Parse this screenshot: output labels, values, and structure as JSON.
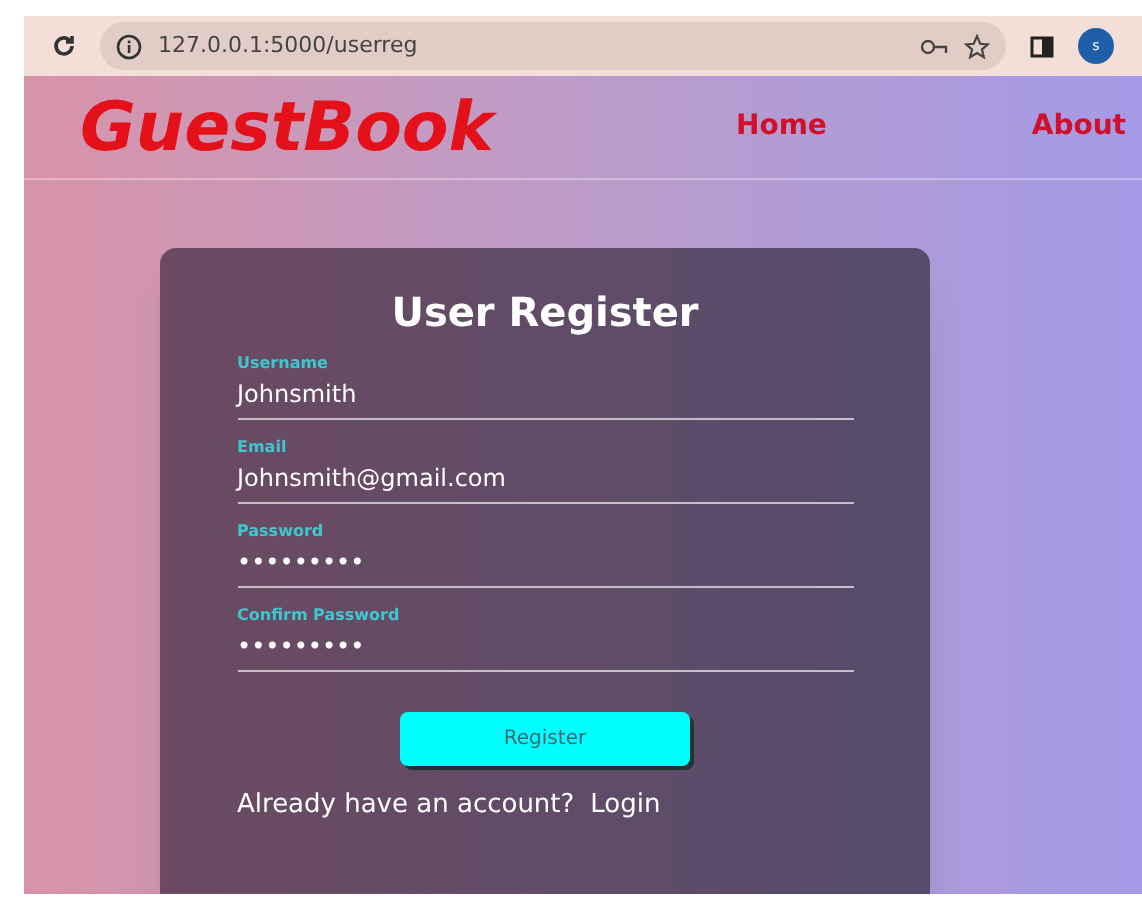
{
  "browser": {
    "url": "127.0.0.1:5000/userreg",
    "profile_initial": "s"
  },
  "header": {
    "logo": "GuestBook",
    "nav": [
      {
        "label": "Home"
      },
      {
        "label": "About"
      }
    ]
  },
  "form": {
    "title": "User Register",
    "fields": [
      {
        "label": "Username",
        "value": "Johnsmith"
      },
      {
        "label": "Email",
        "value": "Johnsmith@gmail.com"
      },
      {
        "label": "Password",
        "value": "•••••••••"
      },
      {
        "label": "Confirm Password",
        "value": "•••••••••"
      }
    ],
    "submit": "Register",
    "footer_text": "Already have an account?",
    "footer_link": "Login"
  }
}
